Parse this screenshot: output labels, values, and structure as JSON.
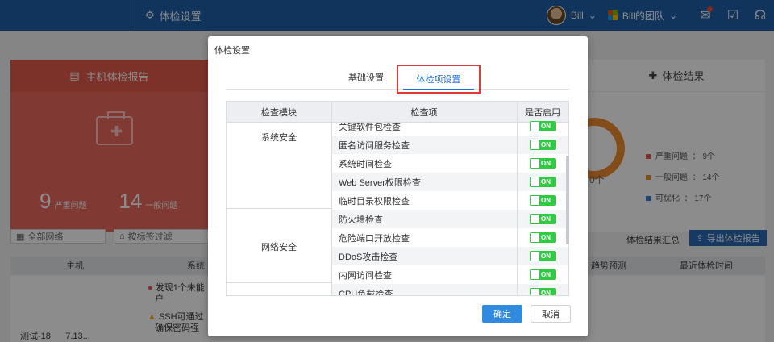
{
  "topbar": {
    "title": "体检设置",
    "user_name": "Bill",
    "team_name": "Bill的团队"
  },
  "background": {
    "main_card_title": "主机体检报告",
    "serious_count": "9",
    "serious_label": "严重问题",
    "general_count": "14",
    "general_label": "一般问题",
    "result_title": "体检结果",
    "ring_text": "0个",
    "legend": [
      {
        "label": "严重问题",
        "value": "：  9个",
        "color": "#e3594a"
      },
      {
        "label": "一般问题",
        "value": "：  14个",
        "color": "#f08a2c"
      },
      {
        "label": "可优化",
        "value": "：  17个",
        "color": "#2f7fd8"
      }
    ],
    "filter_network": "全部网络",
    "filter_tag": "按标签过滤",
    "summary_label": "体检结果汇总",
    "export_label": "导出体检报告",
    "columns": [
      "主机",
      "系统",
      "趋势预测",
      "最近体检时间"
    ],
    "row_msg1": "发现1个未能",
    "row_msg1b": "户",
    "row_msg2": "SSH可通过",
    "row_msg2b": "确保密码强",
    "host_name": "测试-18",
    "host_suffix": "7.13..."
  },
  "dialog": {
    "title": "体检设置",
    "tabs": [
      "基础设置",
      "体检项设置"
    ],
    "headers": {
      "module": "检查模块",
      "item": "检查项",
      "enabled": "是否启用"
    },
    "modules": [
      "系统安全",
      "网络安全"
    ],
    "rows": [
      {
        "label": "关键软件包检查",
        "state": "ON"
      },
      {
        "label": "匿名访问服务检查",
        "state": "ON"
      },
      {
        "label": "系统时间检查",
        "state": "ON"
      },
      {
        "label": "Web Server权限检查",
        "state": "ON"
      },
      {
        "label": "临时目录权限检查",
        "state": "ON"
      },
      {
        "label": "防火墙检查",
        "state": "ON"
      },
      {
        "label": "危险端口开放检查",
        "state": "ON"
      },
      {
        "label": "DDoS攻击检查",
        "state": "ON"
      },
      {
        "label": "内网访问检查",
        "state": "ON"
      },
      {
        "label": "CPU负载检查",
        "state": "ON"
      }
    ],
    "ok_label": "确定",
    "cancel_label": "取消"
  }
}
